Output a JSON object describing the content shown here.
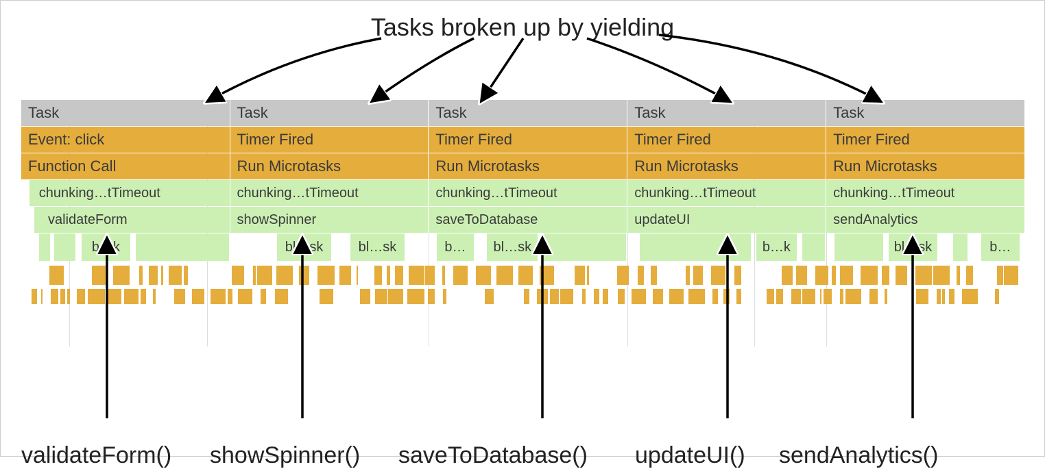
{
  "title": "Tasks broken up by yielding",
  "columns": [
    {
      "task": "Task",
      "event": "Event: click",
      "fn": "Function Call",
      "chunk": "chunking…tTimeout",
      "leaf": "validateForm",
      "bottom_label": "validateForm()"
    },
    {
      "task": "Task",
      "event": "Timer Fired",
      "fn": "Run Microtasks",
      "chunk": "chunking…tTimeout",
      "leaf": "showSpinner",
      "bottom_label": "showSpinner()"
    },
    {
      "task": "Task",
      "event": "Timer Fired",
      "fn": "Run Microtasks",
      "chunk": "chunking…tTimeout",
      "leaf": "saveToDatabase",
      "bottom_label": "saveToDatabase()"
    },
    {
      "task": "Task",
      "event": "Timer Fired",
      "fn": "Run Microtasks",
      "chunk": "chunking…tTimeout",
      "leaf": "updateUI",
      "bottom_label": "updateUI()"
    },
    {
      "task": "Task",
      "event": "Timer Fired",
      "fn": "Run Microtasks",
      "chunk": "chunking…tTimeout",
      "leaf": "sendAnalytics",
      "bottom_label": "sendAnalytics()"
    }
  ],
  "blocks_text": {
    "bk": "b…k",
    "blsk": "bl…sk",
    "b": "b…"
  },
  "colors": {
    "task_bg": "#c7c7c7",
    "gold": "#e4ad3c",
    "green": "#ccf0b4"
  }
}
